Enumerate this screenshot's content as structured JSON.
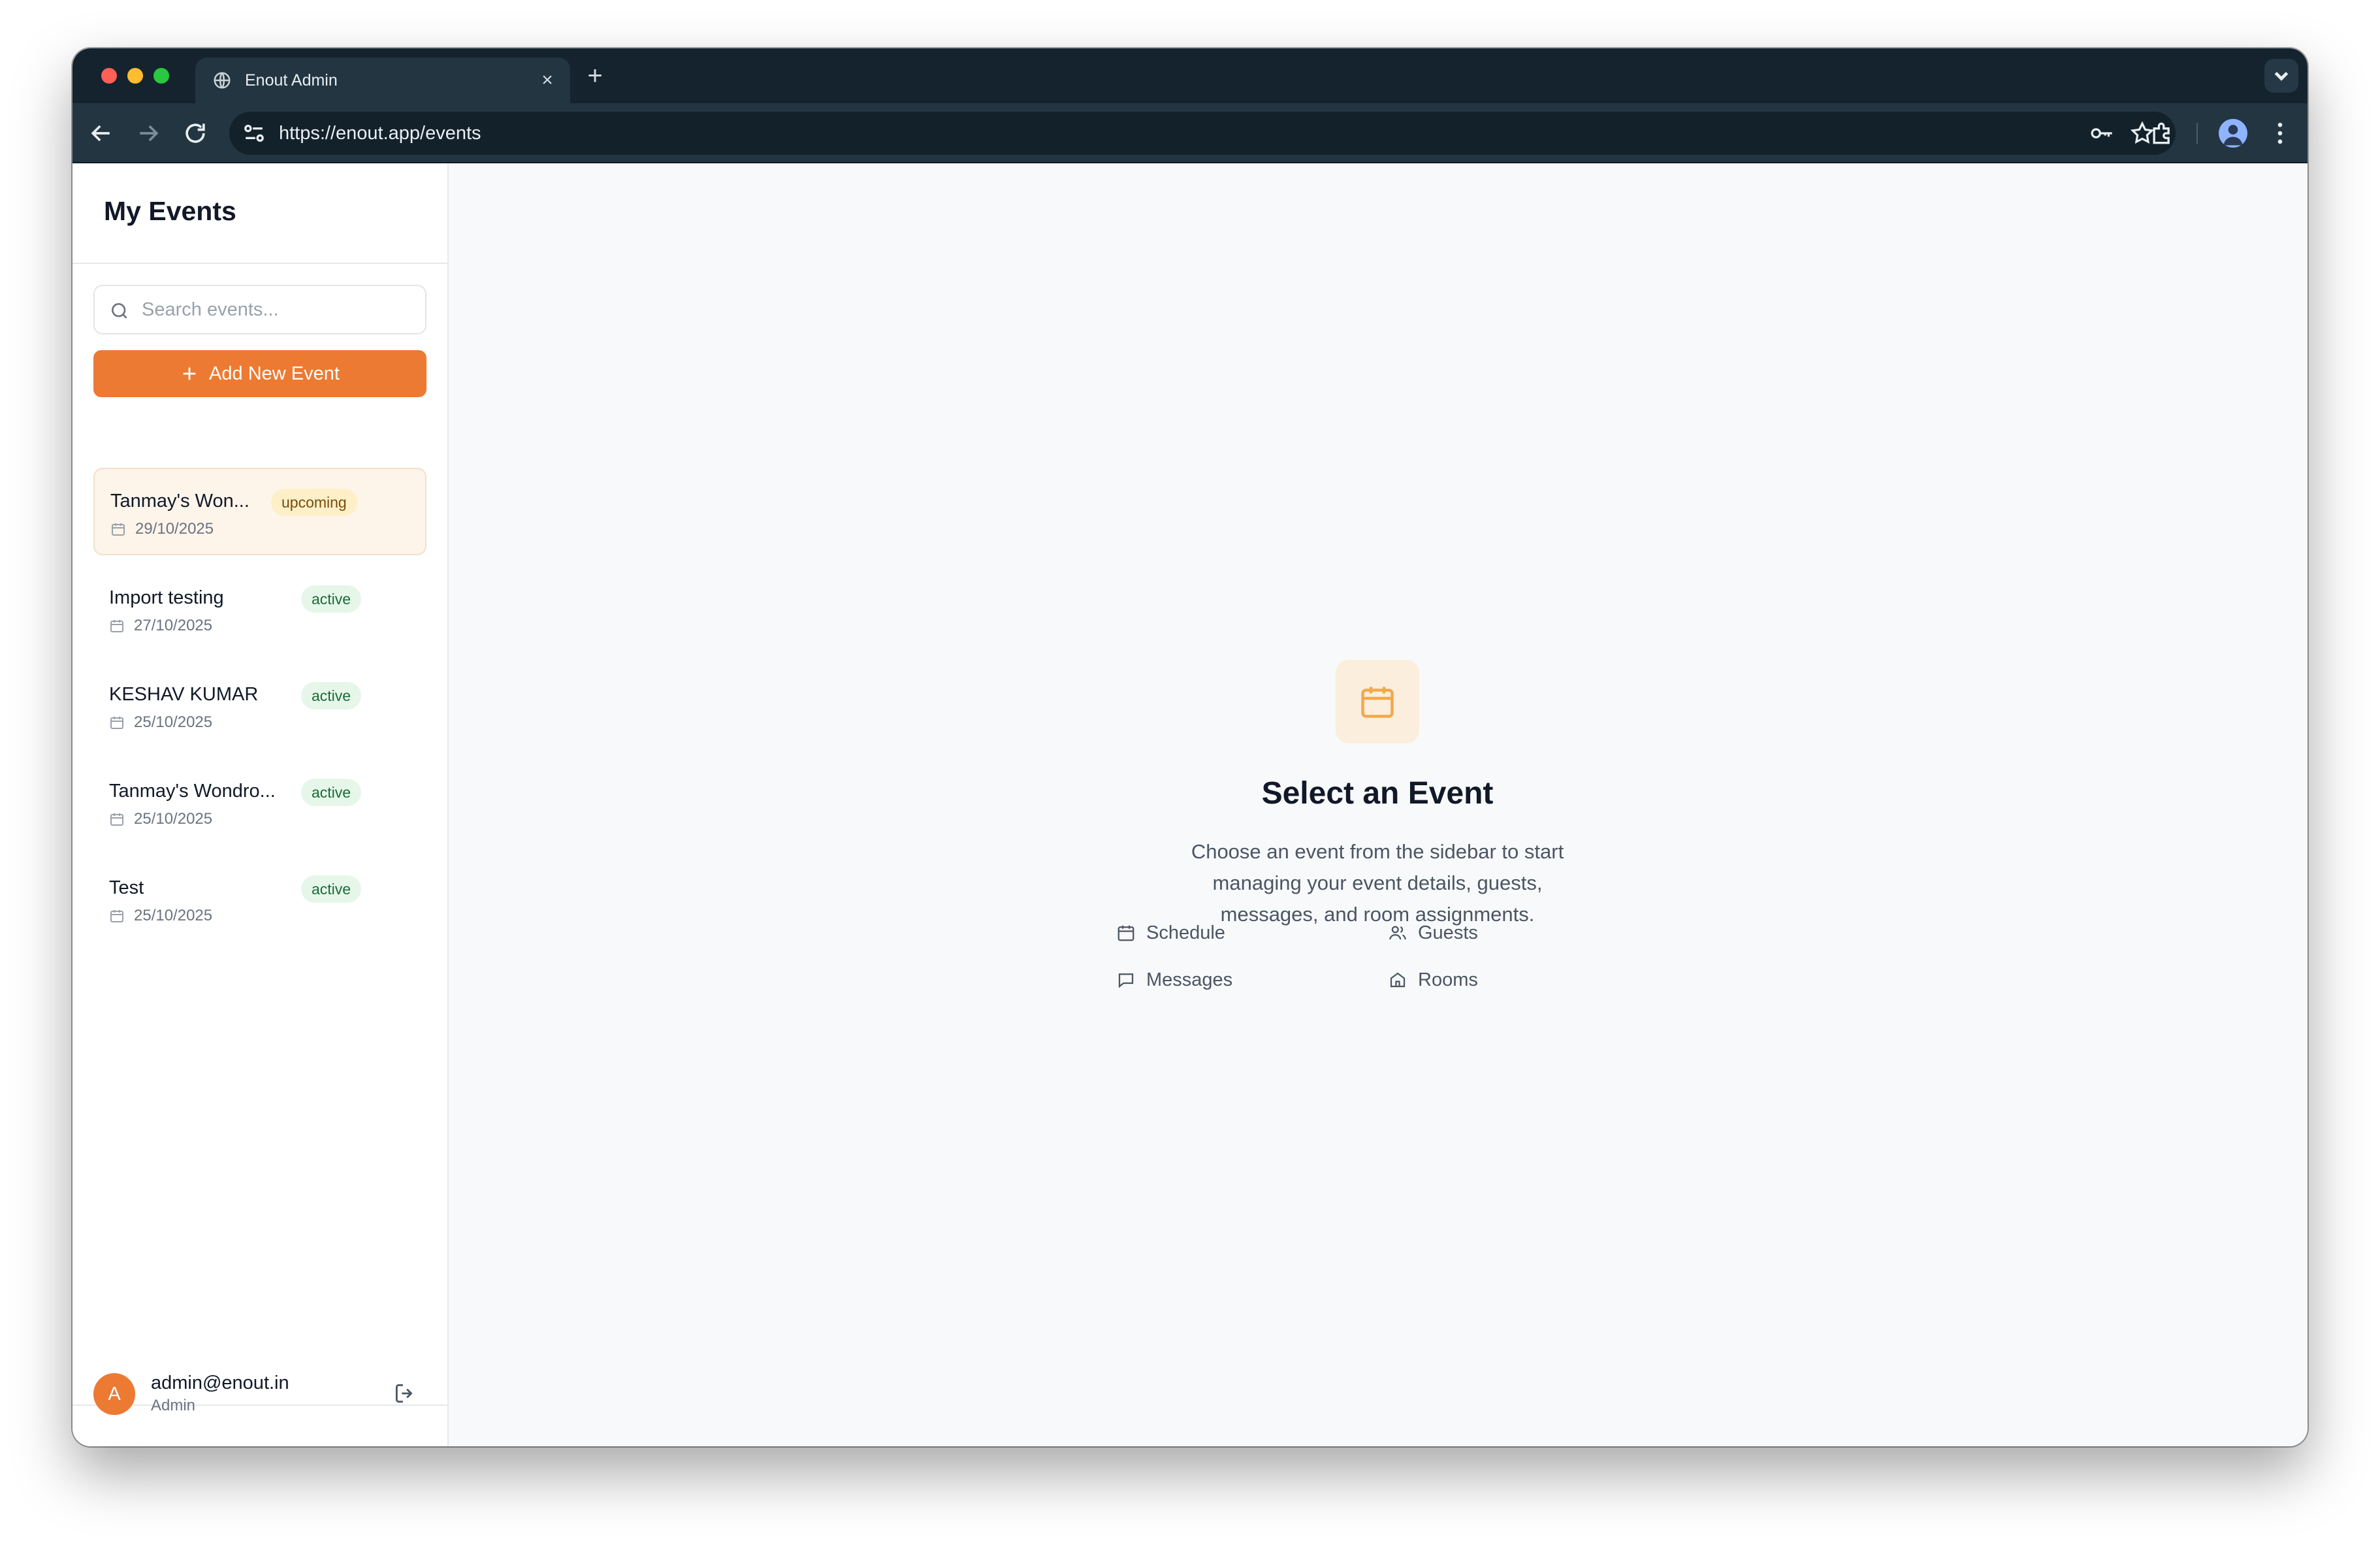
{
  "browser": {
    "tab_title": "Enout Admin",
    "url": "https://enout.app/events"
  },
  "sidebar": {
    "title": "My Events",
    "search_placeholder": "Search events...",
    "add_button_label": "Add New Event",
    "events": [
      {
        "name": "Tanmay's Won...",
        "date": "29/10/2025",
        "status": "upcoming",
        "selected": true
      },
      {
        "name": "Import testing",
        "date": "27/10/2025",
        "status": "active",
        "selected": false
      },
      {
        "name": "KESHAV KUMAR",
        "date": "25/10/2025",
        "status": "active",
        "selected": false
      },
      {
        "name": "Tanmay's Wondro...",
        "date": "25/10/2025",
        "status": "active",
        "selected": false
      },
      {
        "name": "Test",
        "date": "25/10/2025",
        "status": "active",
        "selected": false
      }
    ],
    "user": {
      "initial": "A",
      "email": "admin@enout.in",
      "role": "Admin"
    }
  },
  "main": {
    "title": "Select an Event",
    "description": "Choose an event from the sidebar to start managing your event details, guests, messages, and room assignments.",
    "features": [
      {
        "label": "Schedule",
        "icon": "calendar-icon"
      },
      {
        "label": "Guests",
        "icon": "users-icon"
      },
      {
        "label": "Messages",
        "icon": "message-icon"
      },
      {
        "label": "Rooms",
        "icon": "home-icon"
      }
    ]
  },
  "colors": {
    "accent": "#ec7a33",
    "upcoming_badge": "#fdf0c8",
    "active_badge": "#e6f7ea"
  }
}
